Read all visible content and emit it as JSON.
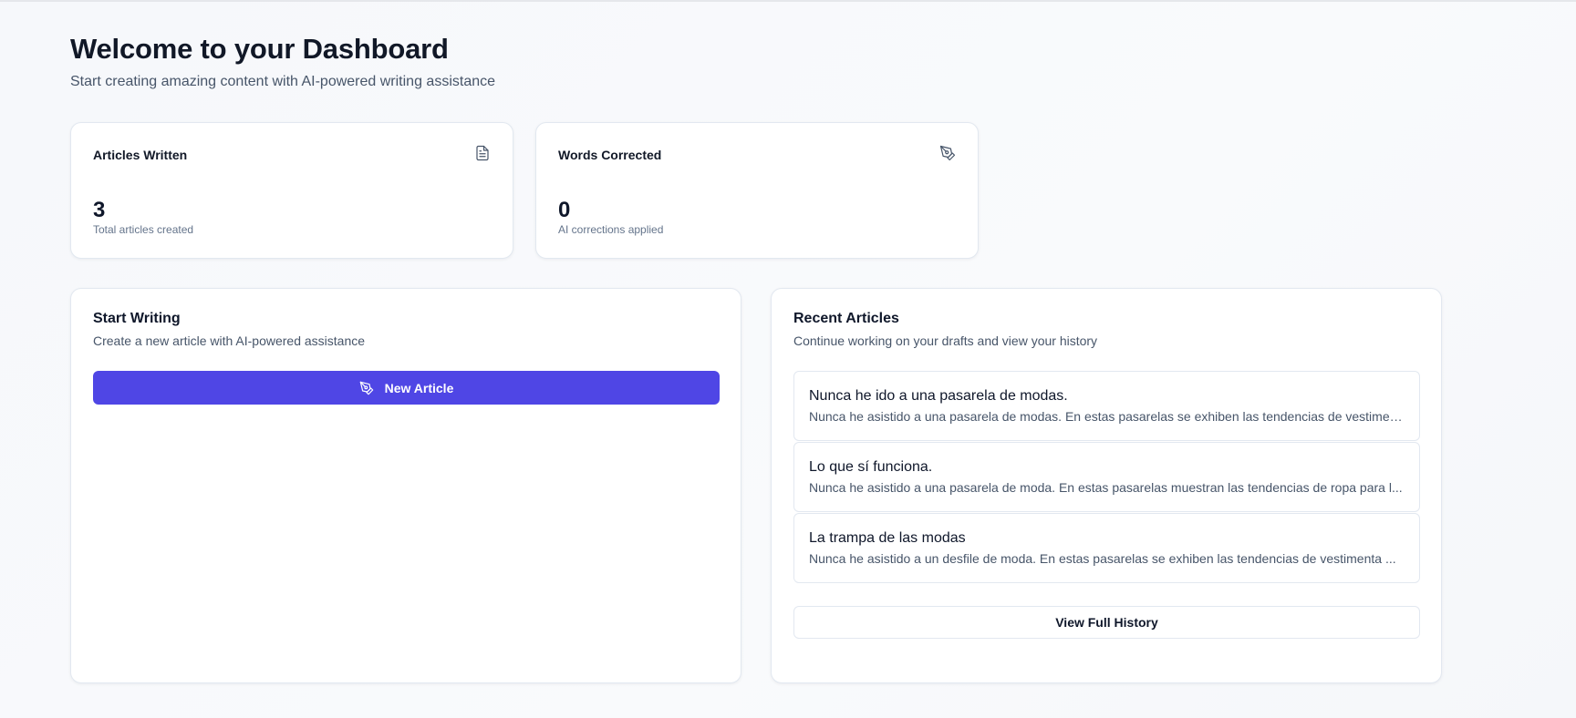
{
  "header": {
    "title": "Welcome to your Dashboard",
    "subtitle": "Start creating amazing content with AI-powered writing assistance"
  },
  "stats": [
    {
      "title": "Articles Written",
      "value": "3",
      "caption": "Total articles created",
      "icon": "document-icon"
    },
    {
      "title": "Words Corrected",
      "value": "0",
      "caption": "AI corrections applied",
      "icon": "pen-tool-icon"
    }
  ],
  "start_writing": {
    "title": "Start Writing",
    "description": "Create a new article with AI-powered assistance",
    "button_label": "New Article",
    "button_icon": "pen-tool-icon"
  },
  "recent_articles": {
    "title": "Recent Articles",
    "description": "Continue working on your drafts and view your history",
    "items": [
      {
        "title": "Nunca he ido a una pasarela de modas.",
        "excerpt": "Nunca he asistido a una pasarela de modas. En estas pasarelas se exhiben las tendencias de vestimen..."
      },
      {
        "title": "Lo que sí funciona.",
        "excerpt": "Nunca he asistido a una pasarela de moda. En estas pasarelas muestran las tendencias de ropa para l..."
      },
      {
        "title": "La trampa de las modas",
        "excerpt": "Nunca he asistido a un desfile de moda. En estas pasarelas se exhiben las tendencias de vestimenta ..."
      }
    ],
    "history_button_label": "View Full History"
  },
  "colors": {
    "primary": "#4f46e5",
    "border": "#e2e8f0",
    "text": "#0f172a",
    "muted": "#64748b"
  }
}
